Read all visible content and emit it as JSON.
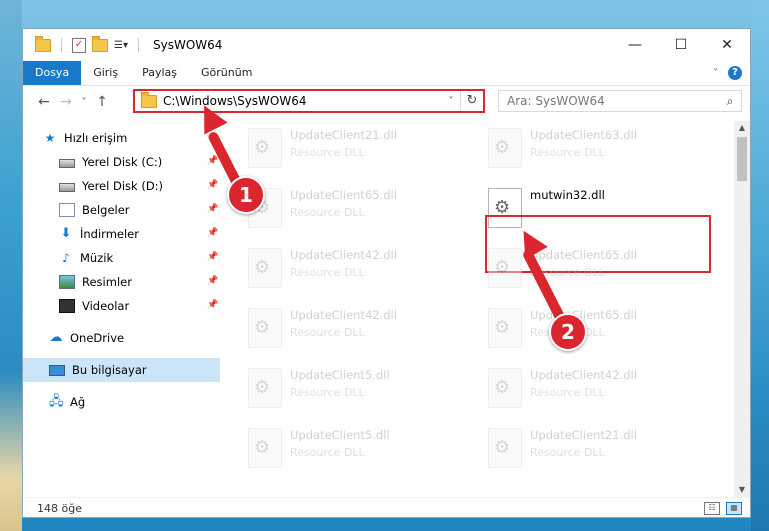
{
  "window": {
    "title": "SysWOW64",
    "controls": {
      "minimize": "—",
      "maximize": "☐",
      "close": "✕"
    }
  },
  "ribbon": {
    "tabs": [
      "Dosya",
      "Giriş",
      "Paylaş",
      "Görünüm"
    ],
    "active_tab": "Dosya",
    "help": "?"
  },
  "nav": {
    "back": "←",
    "forward": "→",
    "recent": "˅",
    "up": "↑",
    "address": "C:\\Windows\\SysWOW64",
    "dropdown": "˅",
    "refresh": "↻",
    "search_placeholder": "Ara: SysWOW64",
    "search_icon": "search-icon"
  },
  "sidebar": {
    "quick_access": "Hızlı erişim",
    "items": [
      {
        "label": "Yerel Disk (C:)",
        "icon": "drive-icon",
        "pinned": true
      },
      {
        "label": "Yerel Disk (D:)",
        "icon": "drive-icon",
        "pinned": true
      },
      {
        "label": "Belgeler",
        "icon": "documents-icon",
        "pinned": true
      },
      {
        "label": "İndirmeler",
        "icon": "downloads-icon",
        "pinned": true
      },
      {
        "label": "Müzik",
        "icon": "music-icon",
        "pinned": true
      },
      {
        "label": "Resimler",
        "icon": "pictures-icon",
        "pinned": true
      },
      {
        "label": "Videolar",
        "icon": "videos-icon",
        "pinned": true
      }
    ],
    "onedrive": "OneDrive",
    "this_pc": "Bu bilgisayar",
    "network": "Ağ"
  },
  "files": [
    {
      "name": "UpdateClient21.dll",
      "desc": "Resource DLL"
    },
    {
      "name": "UpdateClient63.dll",
      "desc": "Resource DLL"
    },
    {
      "name": "UpdateClient65.dll",
      "desc": "Resource DLL"
    },
    {
      "name": "mutwin32.dll",
      "desc": ""
    },
    {
      "name": "UpdateClient42.dll",
      "desc": "Resource DLL"
    },
    {
      "name": "UpdateClient65.dll",
      "desc": "Resource DLL"
    },
    {
      "name": "UpdateClient42.dll",
      "desc": "Resource DLL"
    },
    {
      "name": "UpdateClient65.dll",
      "desc": "Resource DLL"
    },
    {
      "name": "UpdateClient5.dll",
      "desc": "Resource DLL"
    },
    {
      "name": "UpdateClient42.dll",
      "desc": "Resource DLL"
    },
    {
      "name": "UpdateClient5.dll",
      "desc": "Resource DLL"
    },
    {
      "name": "UpdateClient21.dll",
      "desc": "Resource DLL"
    }
  ],
  "status": {
    "count": "148 öğe"
  },
  "annotations": {
    "step1": "1",
    "step2": "2"
  },
  "colors": {
    "accent": "#1979ca",
    "highlight": "#d9262f"
  }
}
